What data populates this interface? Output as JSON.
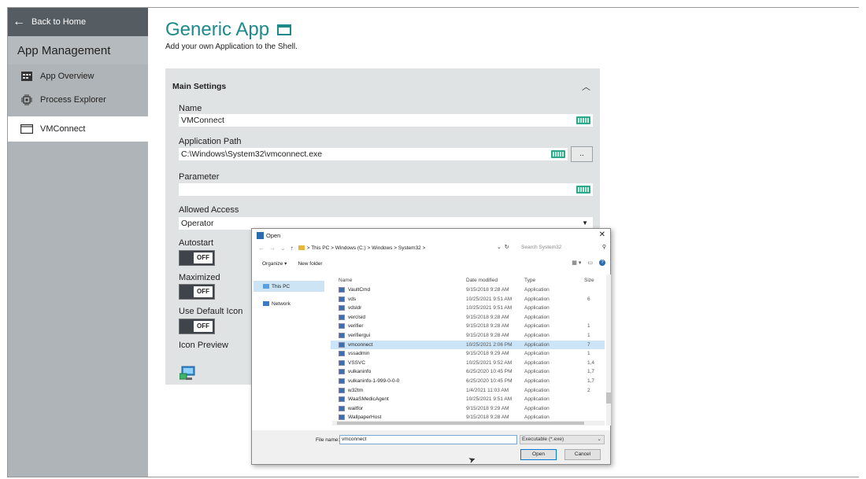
{
  "sidebar": {
    "back_label": "Back to Home",
    "section_title": "App Management",
    "items": [
      {
        "label": "App Overview",
        "icon": "grid-icon"
      },
      {
        "label": "Process Explorer",
        "icon": "chip-icon"
      },
      {
        "label": "VMConnect",
        "icon": "window-icon",
        "active": true
      }
    ]
  },
  "main": {
    "title": "Generic App",
    "subtitle": "Add your own Application to the Shell."
  },
  "settings": {
    "header": "Main Settings",
    "name_label": "Name",
    "name_value": "VMConnect",
    "path_label": "Application Path",
    "path_value": "C:\\Windows\\System32\\vmconnect.exe",
    "browse_label": "..",
    "parameter_label": "Parameter",
    "parameter_value": "",
    "access_label": "Allowed Access",
    "access_value": "Operator",
    "autostart_label": "Autostart",
    "autostart_state": "OFF",
    "maximized_label": "Maximized",
    "maximized_state": "OFF",
    "default_icon_label": "Use Default Icon",
    "default_icon_state": "OFF",
    "icon_preview_label": "Icon Preview"
  },
  "dialog": {
    "title": "Open",
    "path": "> This PC > Windows (C:) > Windows > System32 >",
    "search_placeholder": "Search System32",
    "organize_label": "Organize ▾",
    "new_folder_label": "New folder",
    "nav_pane": [
      {
        "label": "This PC",
        "selected": true
      },
      {
        "label": "Network",
        "selected": false
      }
    ],
    "columns": {
      "name": "Name",
      "date": "Date modified",
      "type": "Type",
      "size": "Size"
    },
    "files": [
      {
        "name": "VaultCmd",
        "date": "9/15/2018 9:28 AM",
        "type": "Application",
        "size": ""
      },
      {
        "name": "vds",
        "date": "10/25/2021 9:51 AM",
        "type": "Application",
        "size": "6"
      },
      {
        "name": "vdsldr",
        "date": "10/25/2021 9:51 AM",
        "type": "Application",
        "size": ""
      },
      {
        "name": "verclsid",
        "date": "9/15/2018 9:28 AM",
        "type": "Application",
        "size": ""
      },
      {
        "name": "verifier",
        "date": "9/15/2018 9:28 AM",
        "type": "Application",
        "size": "1"
      },
      {
        "name": "verifiergui",
        "date": "9/15/2018 9:28 AM",
        "type": "Application",
        "size": "1"
      },
      {
        "name": "vmconnect",
        "date": "10/25/2021 2:06 PM",
        "type": "Application",
        "size": "7",
        "selected": true
      },
      {
        "name": "vssadmin",
        "date": "9/15/2018 9:29 AM",
        "type": "Application",
        "size": "1"
      },
      {
        "name": "VSSVC",
        "date": "10/25/2021 9:52 AM",
        "type": "Application",
        "size": "1,4"
      },
      {
        "name": "vulkaninfo",
        "date": "6/25/2020 10:45 PM",
        "type": "Application",
        "size": "1,7"
      },
      {
        "name": "vulkaninfo-1-999-0-0-0",
        "date": "6/25/2020 10:45 PM",
        "type": "Application",
        "size": "1,7"
      },
      {
        "name": "w32tm",
        "date": "1/4/2021 11:03 AM",
        "type": "Application",
        "size": "2"
      },
      {
        "name": "WaaSMedicAgent",
        "date": "10/25/2021 9:51 AM",
        "type": "Application",
        "size": ""
      },
      {
        "name": "waitfor",
        "date": "9/15/2018 9:29 AM",
        "type": "Application",
        "size": ""
      },
      {
        "name": "WallpaperHost",
        "date": "9/15/2018 9:28 AM",
        "type": "Application",
        "size": ""
      }
    ],
    "filename_label": "File name:",
    "filename_value": "vmconnect",
    "filetype_value": "Executable (*.exe)",
    "open_label": "Open",
    "cancel_label": "Cancel"
  },
  "colors": {
    "accent": "#1f8a8a",
    "sidebar_bg": "#aeb4b8",
    "sidebar_top": "#555d63",
    "panel_bg": "#dfe3e4",
    "keyboard_icon": "#2aa889",
    "selection": "#cce4f7"
  }
}
